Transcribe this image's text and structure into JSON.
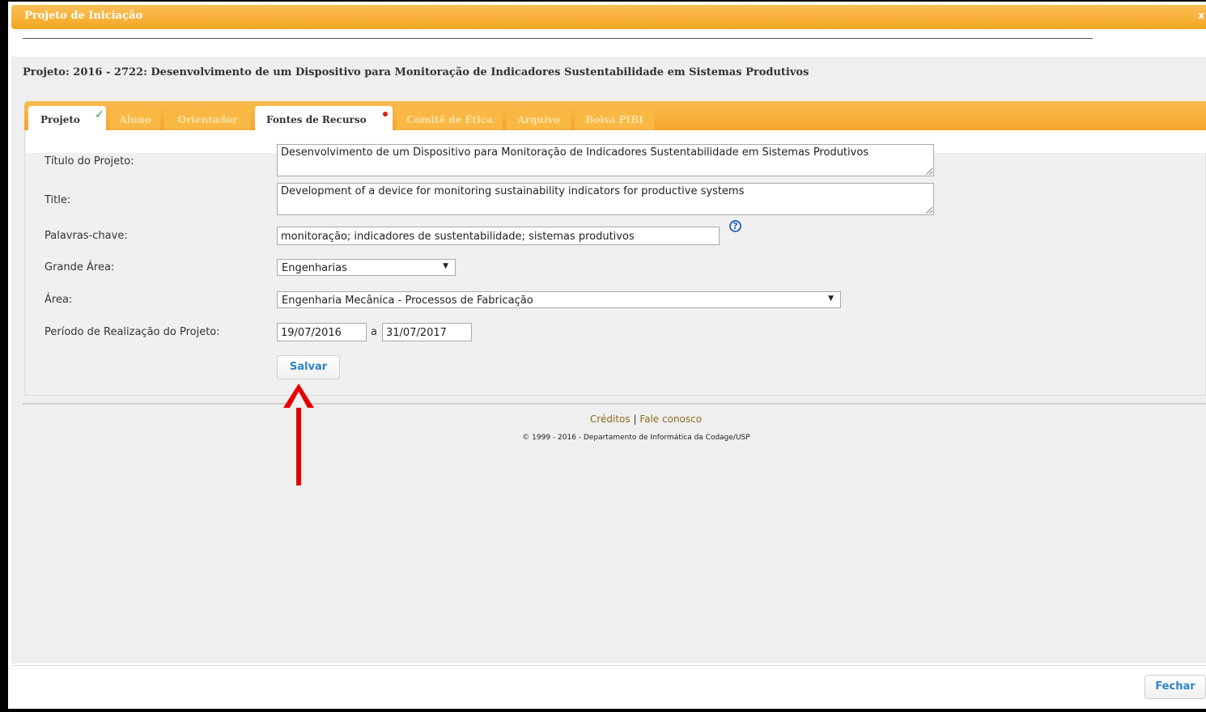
{
  "window": {
    "title": "Projeto de Iniciação",
    "close_glyph": "x"
  },
  "project_line": "Projeto: 2016 - 2722: Desenvolvimento de um Dispositivo para Monitoração de Indicadores Sustentabilidade em Sistemas Produtivos",
  "tabs": [
    {
      "label": "Projeto",
      "active": true,
      "status": "complete"
    },
    {
      "label": "Aluno",
      "active": false
    },
    {
      "label": "Orientador",
      "active": false
    },
    {
      "label": "Fontes de Recurso",
      "active": true,
      "status": "pending"
    },
    {
      "label": "Comitê de Ética",
      "active": false
    },
    {
      "label": "Arquivo",
      "active": false
    },
    {
      "label": "Bolsa PIBI",
      "active": false
    }
  ],
  "form": {
    "titulo_label": "Título do Projeto:",
    "titulo_value": "Desenvolvimento de um Dispositivo para Monitoração de Indicadores Sustentabilidade em Sistemas Produtivos",
    "title_label": "Title:",
    "title_value": "Development of a device for monitoring sustainability indicators for productive systems",
    "palavras_label": "Palavras-chave:",
    "palavras_value": "monitoração; indicadores de sustentabilidade; sistemas produtivos",
    "help_glyph": "?",
    "grande_area_label": "Grande Área:",
    "grande_area_value": "Engenharias",
    "area_label": "Área:",
    "area_value": "Engenharia Mecânica - Processos de Fabricação",
    "periodo_label": "Período de Realização do Projeto:",
    "periodo_inicio": "19/07/2016",
    "periodo_sep": "a",
    "periodo_fim": "31/07/2017",
    "salvar_label": "Salvar"
  },
  "footer": {
    "creditos": "Créditos",
    "sep": "|",
    "fale": "Fale conosco",
    "copyright": "© 1999 - 2016 - Departamento de Informática da Codage/USP"
  },
  "fechar_label": "Fechar",
  "colors": {
    "accent": "#f5a623",
    "link": "#2f83c7",
    "annotation_arrow": "#e60000"
  }
}
